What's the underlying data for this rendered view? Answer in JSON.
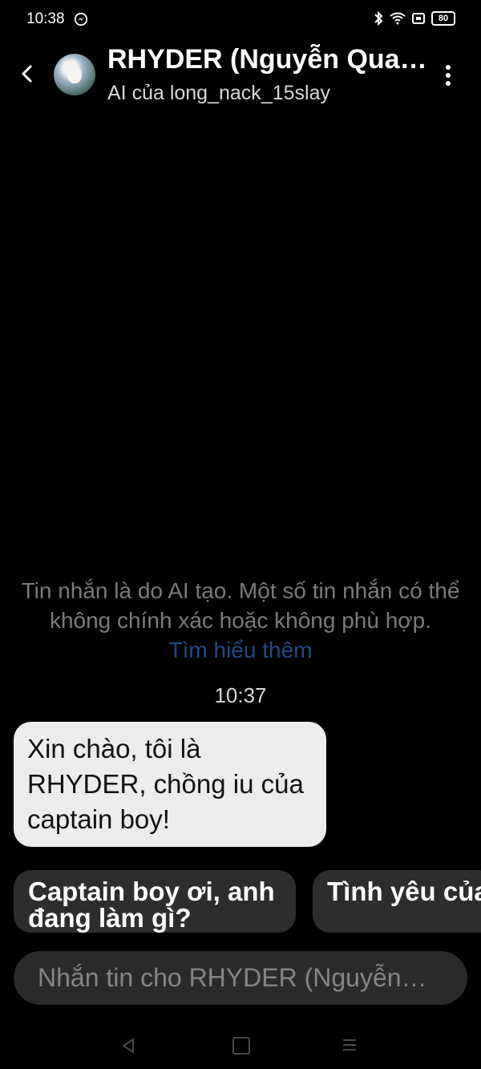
{
  "status": {
    "time": "10:38",
    "battery": "80",
    "icons": [
      "messenger-icon",
      "bluetooth-icon",
      "wifi-icon",
      "screen-icon",
      "battery-icon"
    ]
  },
  "header": {
    "title": "RHYDER (Nguyễn Qua…",
    "subtitle": "AI của long_nack_15slay"
  },
  "chat": {
    "disclaimer": "Tin nhắn là do AI tạo. Một số tin nhắn có thể không chính xác hoặc không phù hợp.",
    "learn_more": "Tìm hiểu thêm",
    "timestamp": "10:37",
    "messages": [
      {
        "sender": "RHYDER",
        "text": "Xin chào, tôi là RHYDER, chồng iu của captain boy!"
      }
    ]
  },
  "suggestions": [
    {
      "label": "Captain boy ơi, anh đang làm gì?"
    },
    {
      "label": "Tình yêu của bạn như thế"
    }
  ],
  "composer": {
    "placeholder": "Nhắn tin cho RHYDER (Nguyễn…"
  },
  "colors": {
    "background": "#000000",
    "bubble": "#ececef",
    "chip": "#2d2d2d",
    "link": "#234a86"
  }
}
